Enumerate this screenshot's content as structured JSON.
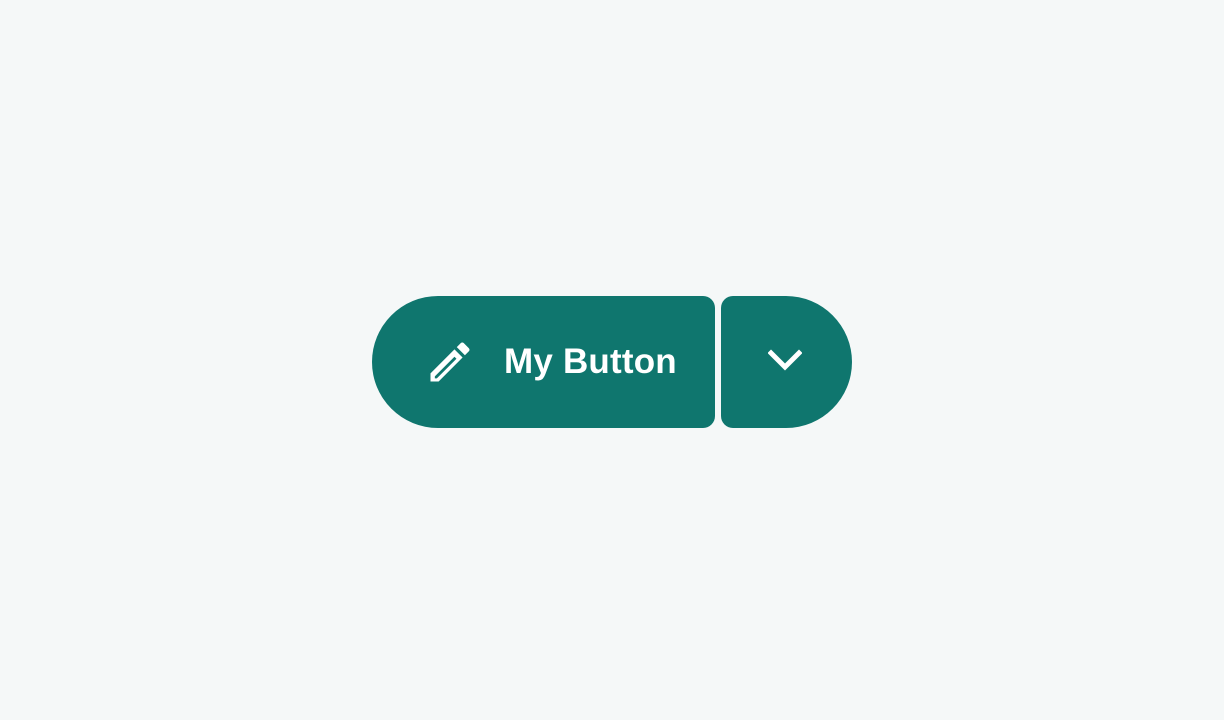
{
  "split_button": {
    "label": "My Button",
    "leading_icon": "pencil-icon",
    "menu_icon": "chevron-down-icon",
    "accent_color": "#0f766e",
    "text_color": "#ffffff"
  },
  "page": {
    "background_color": "#f5f8f8"
  }
}
